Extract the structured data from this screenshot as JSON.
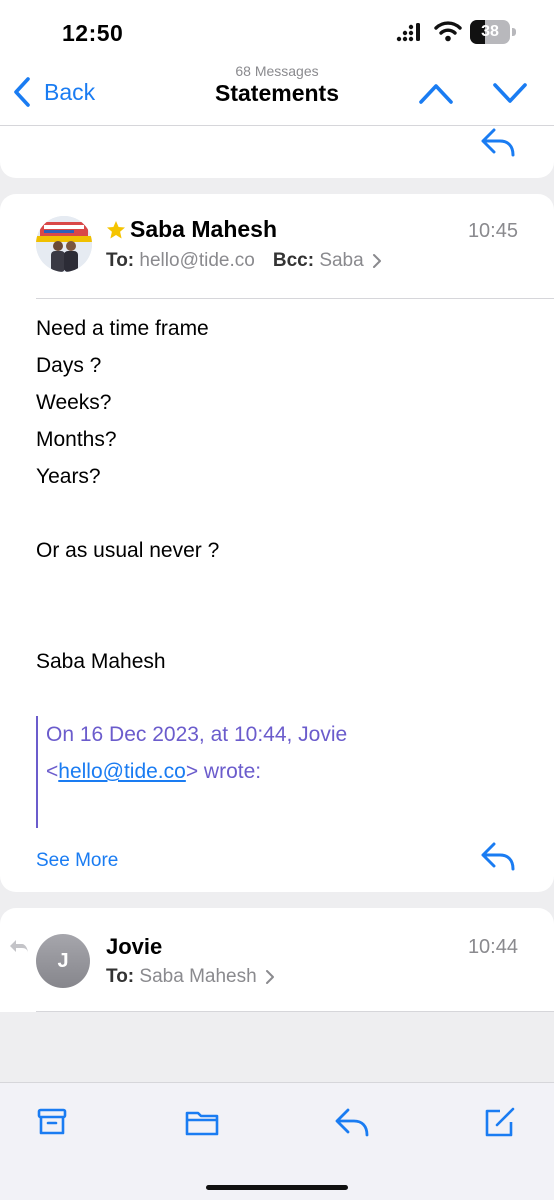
{
  "status_bar": {
    "time": "12:50",
    "battery": "38",
    "battery_level": 0.38,
    "icons": [
      "signal-icon",
      "wifi-icon",
      "battery-icon"
    ]
  },
  "nav": {
    "back_label": "Back",
    "subtitle": "68 Messages",
    "title": "Statements",
    "icons": [
      "chevron-left-icon",
      "chevron-up-icon",
      "chevron-down-icon"
    ]
  },
  "message": {
    "sender": "Saba Mahesh",
    "starred": true,
    "time": "10:45",
    "to_label": "To:",
    "to_value": "hello@tide.co",
    "bcc_label": "Bcc:",
    "bcc_value": "Saba",
    "body": [
      "Need a time frame",
      "Days ?",
      "Weeks?",
      "Months?",
      "Years?",
      "",
      "Or as usual never ?",
      "",
      "",
      "Saba Mahesh"
    ],
    "quote_line1": "On 16 Dec 2023, at 10:44, Jovie",
    "quote_lt": "<",
    "quote_email": "hello@tide.co",
    "quote_end": "> wrote:",
    "see_more": "See More"
  },
  "next_message": {
    "avatar_initial": "J",
    "sender": "Jovie",
    "time": "10:44",
    "to_label": "To:",
    "to_value": "Saba Mahesh"
  },
  "toolbar": {
    "icons": [
      "archive-icon",
      "folder-icon",
      "reply-icon",
      "compose-icon"
    ]
  },
  "colors": {
    "accent": "#1a7cf2",
    "quote": "#6b5ccc",
    "star": "#f5c400",
    "background": "#eeeef0"
  }
}
